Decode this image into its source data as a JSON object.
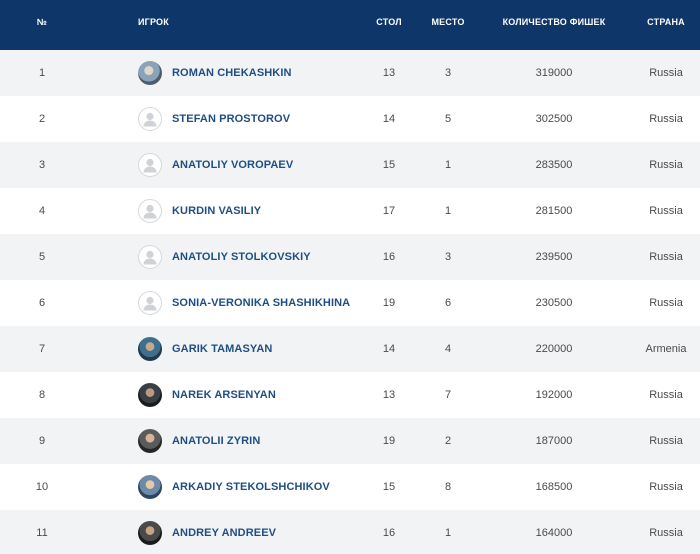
{
  "header": {
    "num": "№",
    "player": "ИГРОК",
    "table": "СТОЛ",
    "seat": "МЕСТО",
    "chips": "КОЛИЧЕСТВО ФИШЕК",
    "country": "СТРАНА"
  },
  "colors": {
    "header_bg": "#0e3668",
    "name_color": "#1f4e82",
    "row_alt": "#f2f3f5"
  },
  "rows": [
    {
      "num": "1",
      "name": "ROMAN CHEKASHKIN",
      "table": "13",
      "seat": "3",
      "chips": "319000",
      "country": "Russia",
      "avatar": "photo"
    },
    {
      "num": "2",
      "name": "STEFAN PROSTOROV",
      "table": "14",
      "seat": "5",
      "chips": "302500",
      "country": "Russia",
      "avatar": "placeholder"
    },
    {
      "num": "3",
      "name": "ANATOLIY VOROPAEV",
      "table": "15",
      "seat": "1",
      "chips": "283500",
      "country": "Russia",
      "avatar": "placeholder"
    },
    {
      "num": "4",
      "name": "KURDIN VASILIY",
      "table": "17",
      "seat": "1",
      "chips": "281500",
      "country": "Russia",
      "avatar": "placeholder"
    },
    {
      "num": "5",
      "name": "ANATOLIY STOLKOVSKIY",
      "table": "16",
      "seat": "3",
      "chips": "239500",
      "country": "Russia",
      "avatar": "placeholder"
    },
    {
      "num": "6",
      "name": "SONIA-VERONIKA SHASHIKHINA",
      "table": "19",
      "seat": "6",
      "chips": "230500",
      "country": "Russia",
      "avatar": "placeholder"
    },
    {
      "num": "7",
      "name": "GARIK TAMASYAN",
      "table": "14",
      "seat": "4",
      "chips": "220000",
      "country": "Armenia",
      "avatar": "photo"
    },
    {
      "num": "8",
      "name": "NAREK ARSENYAN",
      "table": "13",
      "seat": "7",
      "chips": "192000",
      "country": "Russia",
      "avatar": "photo"
    },
    {
      "num": "9",
      "name": "ANATOLII ZYRIN",
      "table": "19",
      "seat": "2",
      "chips": "187000",
      "country": "Russia",
      "avatar": "photo"
    },
    {
      "num": "10",
      "name": "ARKADIY STEKOLSHCHIKOV",
      "table": "15",
      "seat": "8",
      "chips": "168500",
      "country": "Russia",
      "avatar": "photo"
    },
    {
      "num": "11",
      "name": "ANDREY ANDREEV",
      "table": "16",
      "seat": "1",
      "chips": "164000",
      "country": "Russia",
      "avatar": "photo"
    }
  ]
}
